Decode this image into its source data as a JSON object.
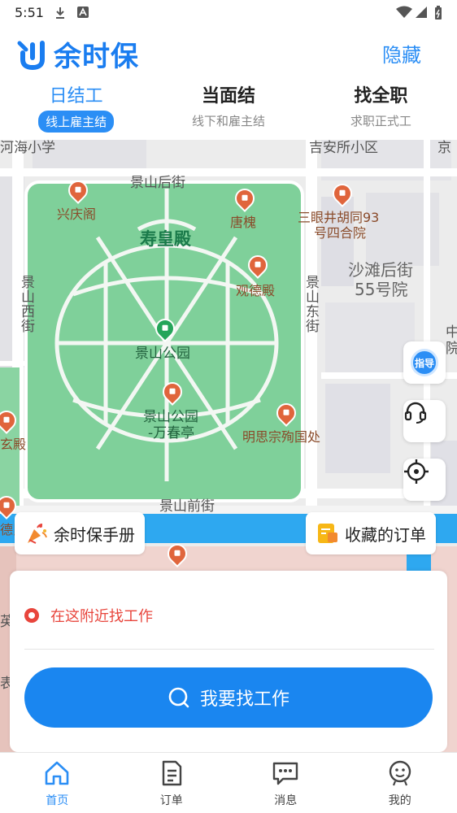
{
  "status_bar": {
    "time": "5:51"
  },
  "header": {
    "app_name": "余时保",
    "hide_label": "隐藏"
  },
  "tabs": [
    {
      "label": "日结工",
      "sub": "线上雇主结",
      "active": true
    },
    {
      "label": "当面结",
      "sub": "线下和雇主结",
      "active": false
    },
    {
      "label": "找全职",
      "sub": "求职正式工",
      "active": false
    }
  ],
  "map": {
    "labels": {
      "school": "河海小学",
      "community": "吉安所小区",
      "east": "京",
      "jingshan_back_st": "景山后街",
      "xingqing": "兴庆阁",
      "tanghuai": "唐槐",
      "sanyan": "三眼井胡同93",
      "sanyan2": "号四合院",
      "shouhuang": "寿皇殿",
      "guande": "观德殿",
      "jingshan_west": "景山西街",
      "jingshan_east": "景山东街",
      "shatan": "沙滩后街",
      "shatan2": "55号院",
      "zhong": "中",
      "yuan": "院",
      "park": "景山公园",
      "wanchun": "景山公园",
      "wanchun2": "-万春亭",
      "chongzhen": "明思宗殉国处",
      "xuan": "玄殿",
      "jingshan_front": "景山前街",
      "de": "德民",
      "ying": "英",
      "biao": "表"
    }
  },
  "fabs": {
    "guide": "指导"
  },
  "chips": {
    "manual": "余时保手册",
    "saved_orders": "收藏的订单"
  },
  "card": {
    "nearby_text": "在这附近找工作",
    "search_button": "我要找工作"
  },
  "bottom_nav": [
    {
      "label": "首页",
      "active": true
    },
    {
      "label": "订单",
      "active": false
    },
    {
      "label": "消息",
      "active": false
    },
    {
      "label": "我的",
      "active": false
    }
  ],
  "colors": {
    "accent": "#2b8ef5",
    "park": "#7fd09a",
    "water": "#2ea8f0",
    "alert": "#e8453c"
  }
}
